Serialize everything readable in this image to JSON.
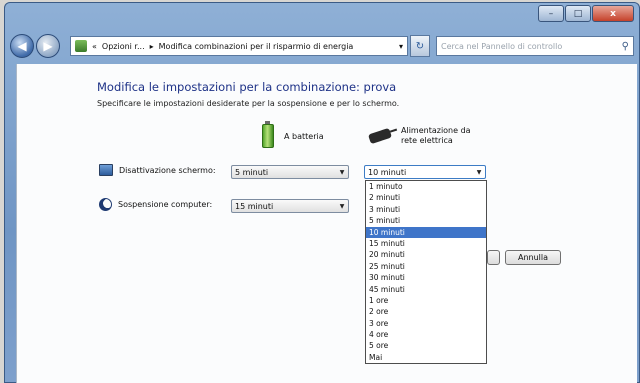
{
  "window": {
    "minimize_glyph": "–",
    "maximize_glyph": "□",
    "close_glyph": "x"
  },
  "navbar": {
    "back_glyph": "◀",
    "forward_glyph": "▶",
    "breadcrumb_chevron": "«",
    "crumb1": "Opzioni r...",
    "sep": "▸",
    "crumb2": "Modifica combinazioni per il risparmio di energia",
    "dropdown_glyph": "▾",
    "refresh_glyph": "↻",
    "search_placeholder": "Cerca nel Pannello di controllo",
    "search_glyph": "⚲"
  },
  "main": {
    "title": "Modifica le impostazioni per la combinazione: prova",
    "subtitle": "Specificare le impostazioni desiderate per la sospensione e per lo schermo.",
    "col_battery": "A batteria",
    "col_ac_line1": "Alimentazione da",
    "col_ac_line2": "rete elettrica",
    "display_label": "Disattivazione schermo:",
    "display_battery_value": "5 minuti",
    "display_ac_value": "10 minuti",
    "sleep_label": "Sospensione computer:",
    "sleep_battery_value": "15 minuti",
    "cancel_button": "Annulla"
  },
  "dropdown_options": [
    "1 minuto",
    "2 minuti",
    "3 minuti",
    "5 minuti",
    "10 minuti",
    "15 minuti",
    "20 minuti",
    "25 minuti",
    "30 minuti",
    "45 minuti",
    "1 ore",
    "2 ore",
    "3 ore",
    "4 ore",
    "5 ore",
    "Mai"
  ],
  "dropdown_selected_index": 4,
  "colors": {
    "title": "#1e3287",
    "selection": "#3f75c9"
  }
}
